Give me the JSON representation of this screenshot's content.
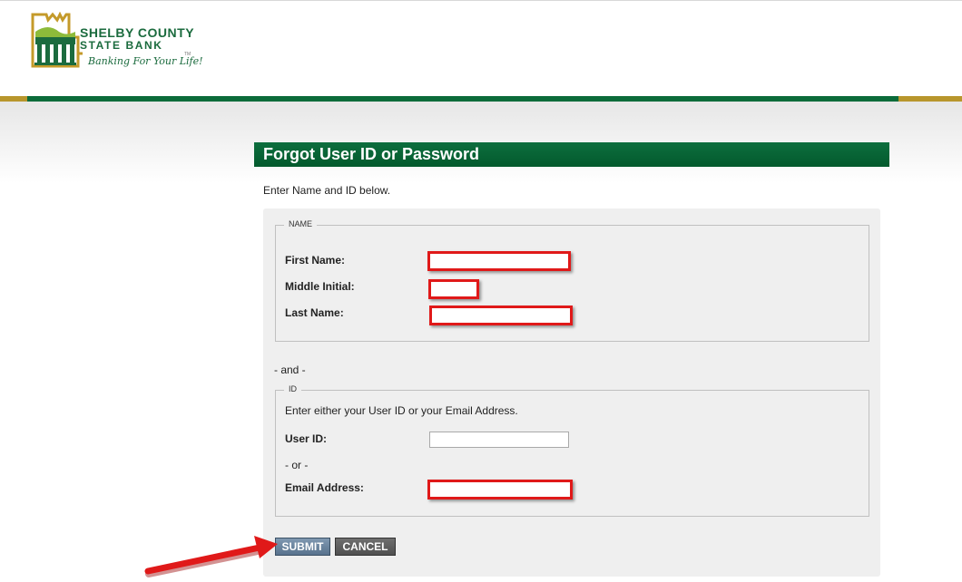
{
  "brand": {
    "name_line1": "SHELBY COUNTY",
    "name_line2": "STATE BANK",
    "tagline": "Banking For Your Life!",
    "trademark": "TM",
    "primary_color": "#0b6b3a",
    "accent_color": "#b8962c"
  },
  "page": {
    "title": "Forgot User ID or Password",
    "intro": "Enter Name and ID below."
  },
  "name_section": {
    "legend": "NAME",
    "first_name_label": "First Name:",
    "first_name_value": "",
    "middle_initial_label": "Middle Initial:",
    "middle_initial_value": "",
    "last_name_label": "Last Name:",
    "last_name_value": ""
  },
  "separator_and": "- and -",
  "id_section": {
    "legend": "ID",
    "instructions": "Enter either your User ID or your Email Address.",
    "user_id_label": "User ID:",
    "user_id_value": "",
    "or_text": "- or -",
    "email_label": "Email Address:",
    "email_value": ""
  },
  "buttons": {
    "submit_label": "SUBMIT",
    "cancel_label": "CANCEL"
  },
  "annotation": {
    "highlight_color": "#e01919",
    "arrow_target": "submit-button"
  }
}
